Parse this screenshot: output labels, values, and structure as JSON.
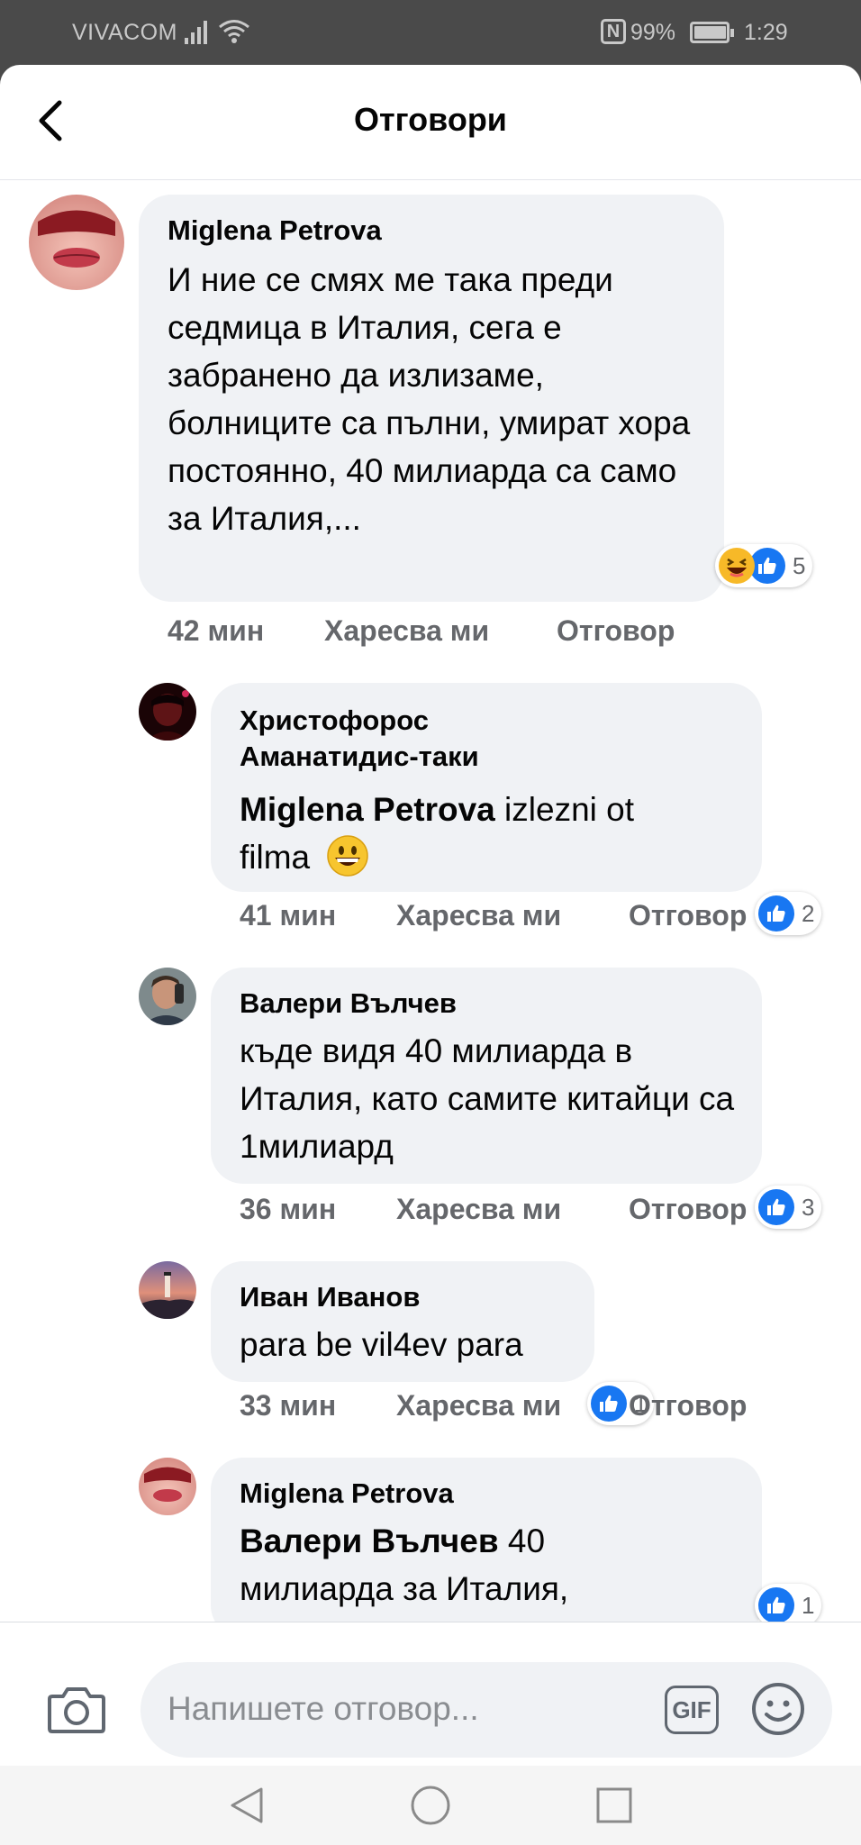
{
  "status_bar": {
    "carrier": "VIVACOM",
    "battery_percent": "99%",
    "time": "1:29",
    "nfc": "N"
  },
  "header": {
    "title": "Отговори"
  },
  "actions": {
    "like": "Харесва ми",
    "reply": "Отговор"
  },
  "comments": [
    {
      "author": "Miglena Petrova",
      "text": "И ние се смях ме така преди седмица в Италия, сега е забранено да излизаме, болниците са пълни, умират хора постоянно, 40 милиарда са само за Италия,...",
      "time": "42 мин",
      "reaction_count": "5",
      "reactions": [
        "haha",
        "like"
      ]
    },
    {
      "author_line1": "Христофорос",
      "author_line2": "Аманатидис-таки",
      "mention": "Miglena Petrova",
      "text_after_mention_1": " izlezni ot",
      "text_line2": "filma",
      "emoji": "😀",
      "time": "41 мин",
      "reaction_count": "2",
      "reactions": [
        "like"
      ]
    },
    {
      "author": "Валери Вълчев",
      "text": "къде видя 40  милиарда в Италия, като самите китайци са 1милиард",
      "time": "36 мин",
      "reaction_count": "3",
      "reactions": [
        "like"
      ]
    },
    {
      "author": "Иван Иванов",
      "text": "para be vil4ev para",
      "time": "33 мин",
      "reaction_count": "1",
      "reactions": [
        "like"
      ]
    },
    {
      "author": "Miglena Petrova",
      "mention": "Валери Вълчев",
      "text_after_mention_1": " 40",
      "text_line2": "милиарда за Италия,",
      "reaction_count": "1",
      "reactions": [
        "like"
      ]
    }
  ],
  "composer": {
    "placeholder": "Напишете отговор...",
    "gif_label": "GIF"
  },
  "colors": {
    "like_blue": "#1877f2",
    "bubble_bg": "#f0f2f5",
    "meta_gray": "#65676b",
    "status_bar_bg": "#4a4a4a"
  }
}
